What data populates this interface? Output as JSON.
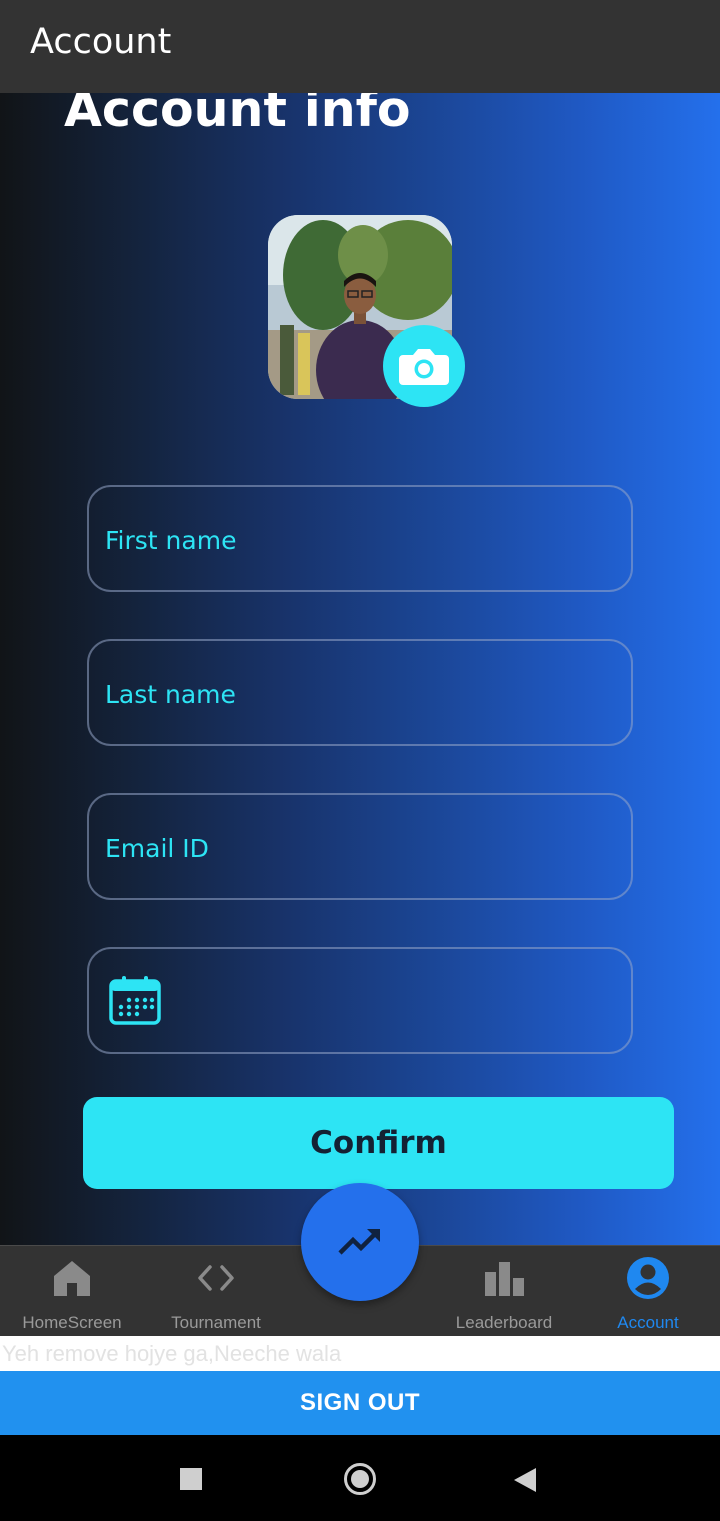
{
  "appbar": {
    "title": "Account"
  },
  "page": {
    "title": "Account info"
  },
  "avatar": {
    "alt": "Profile photo"
  },
  "form": {
    "fields": [
      {
        "label": "First name",
        "value": ""
      },
      {
        "label": "Last name",
        "value": ""
      },
      {
        "label": "Email ID",
        "value": ""
      },
      {
        "label": "",
        "value": "",
        "icon": "calendar-icon"
      }
    ],
    "confirm_label": "Confirm"
  },
  "bottom_nav": {
    "items": [
      {
        "label": "HomeScreen",
        "icon": "home-icon",
        "active": false
      },
      {
        "label": "Tournament",
        "icon": "code-icon",
        "active": false
      },
      {
        "label": "Leaderboard",
        "icon": "bar-chart-icon",
        "active": false
      },
      {
        "label": "Account",
        "icon": "account-circle-icon",
        "active": true
      }
    ],
    "fab_icon": "trending-up-icon"
  },
  "footer_note": "Yeh remove hojye ga,Neeche wala",
  "signout_label": "SIGN OUT",
  "colors": {
    "accent": "#2de4f4",
    "primary_blue": "#2470ec",
    "appbar": "#333333",
    "active_nav": "#1f88f0",
    "signout": "#2191ef"
  }
}
